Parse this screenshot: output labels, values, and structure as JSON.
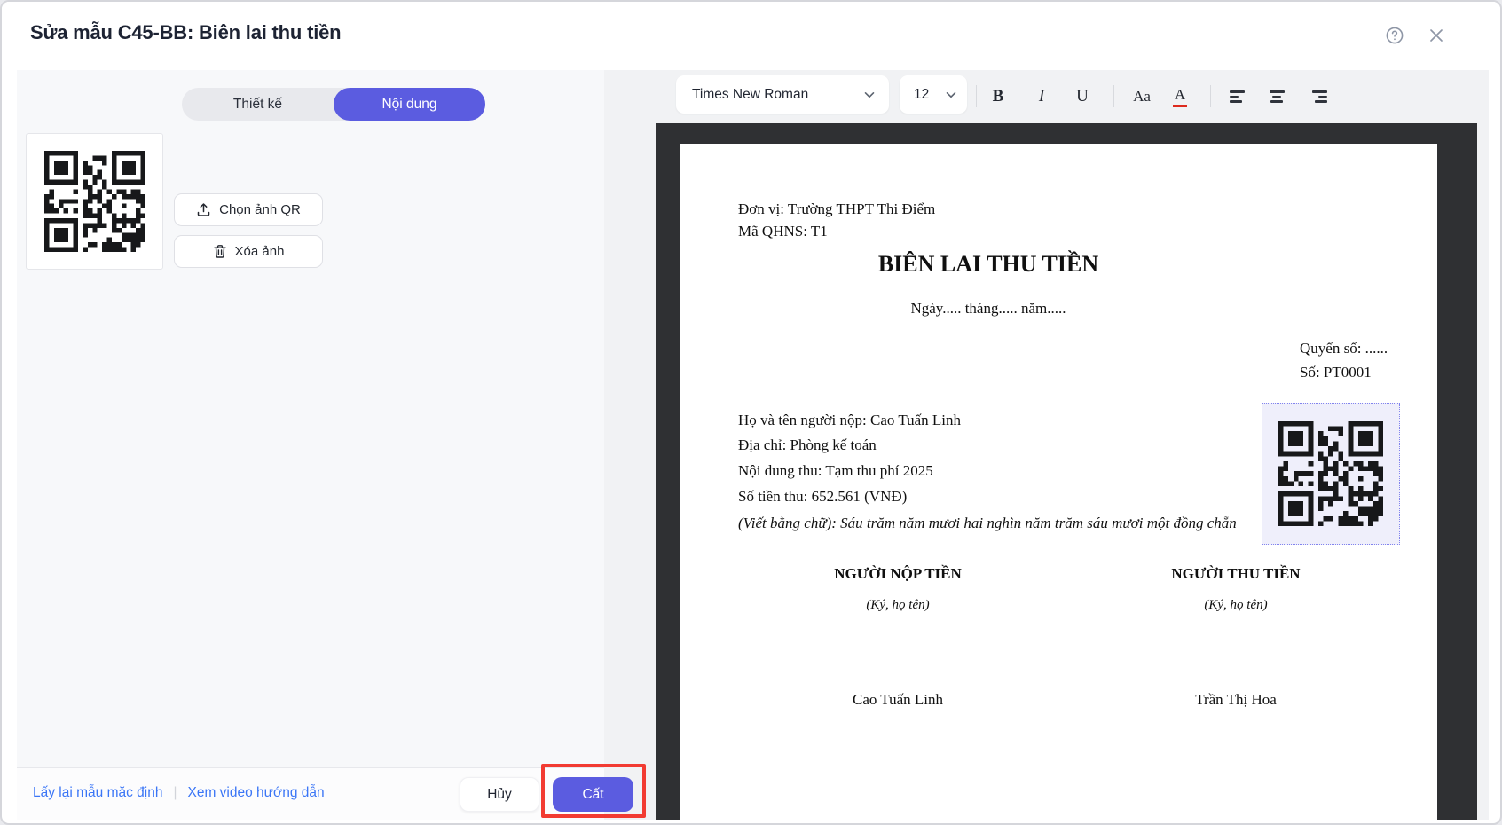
{
  "header": {
    "title": "Sửa mẫu C45-BB: Biên lai thu tiền"
  },
  "tabs": {
    "design": "Thiết kế",
    "content": "Nội dung"
  },
  "qr_panel": {
    "choose_button": "Chọn ảnh QR",
    "delete_button": "Xóa ảnh"
  },
  "toolbar": {
    "font_family": "Times New Roman",
    "font_size": "12",
    "bold": "B",
    "italic": "I",
    "underline": "U",
    "case": "Aa",
    "text_color": "A"
  },
  "document": {
    "unit": "Đơn vị: Trường THPT Thi Điểm",
    "code": "Mã QHNS: T1",
    "title": "BIÊN LAI THU TIỀN",
    "date_line": "Ngày..... tháng..... năm.....",
    "book_no": "Quyển số: ......",
    "receipt_no": "Số: PT0001",
    "payer": "Họ và tên người nộp: Cao Tuấn Linh",
    "address": "Địa chỉ: Phòng kế toán",
    "content": "Nội dung thu: Tạm thu phí 2025",
    "amount": "Số tiền thu: 652.561 (VNĐ)",
    "amount_words": "(Viết bằng chữ): Sáu trăm năm mươi hai nghìn năm trăm sáu mươi một đồng chẵn",
    "payer_title": "NGƯỜI NỘP TIỀN",
    "collector_title": "NGƯỜI THU TIỀN",
    "sign_note": "(Ký, họ tên)",
    "payer_name": "Cao Tuấn Linh",
    "collector_name": "Trần Thị Hoa"
  },
  "footer": {
    "reset_link": "Lấy lại mẫu mặc định",
    "link_separator": "|",
    "video_link": "Xem video hướng dẫn",
    "cancel_button": "Hủy",
    "save_button": "Cất"
  },
  "colors": {
    "accent": "#5b5ce0",
    "annotation_red": "#f23b32",
    "text_color_underline": "#dd2a1e",
    "link_blue": "#3b76f6",
    "viewer_background": "#2f3033",
    "panel_background": "#f7f8fa"
  }
}
